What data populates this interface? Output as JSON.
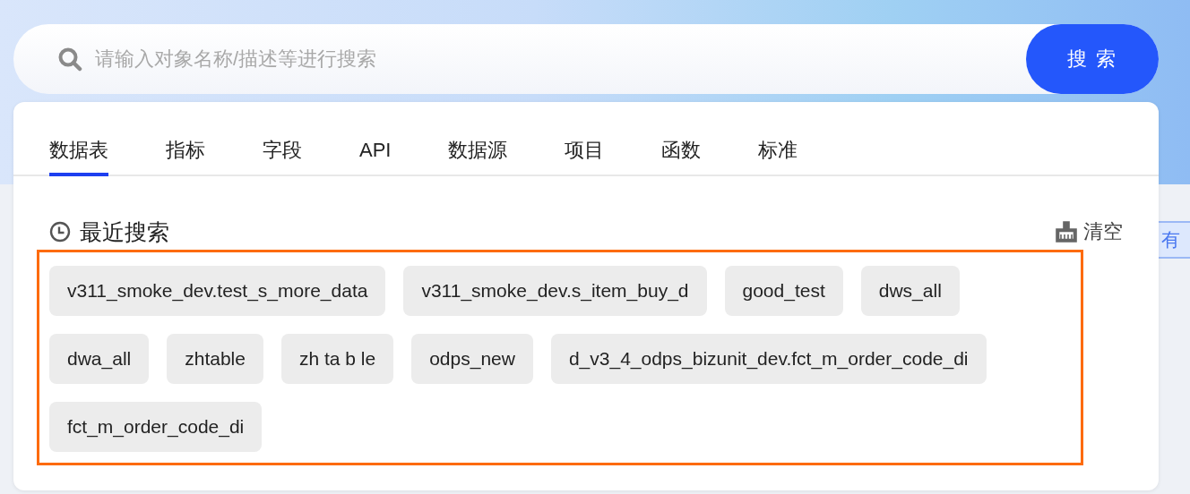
{
  "search": {
    "placeholder": "请输入对象名称/描述等进行搜索",
    "button": "搜 索"
  },
  "background": {
    "link_fragment": "有"
  },
  "tabs": [
    {
      "label": "数据表",
      "selected": true
    },
    {
      "label": "指标",
      "selected": false
    },
    {
      "label": "字段",
      "selected": false
    },
    {
      "label": "API",
      "selected": false
    },
    {
      "label": "数据源",
      "selected": false
    },
    {
      "label": "项目",
      "selected": false
    },
    {
      "label": "函数",
      "selected": false
    },
    {
      "label": "标准",
      "selected": false
    }
  ],
  "recent": {
    "title": "最近搜索",
    "clear": "清空",
    "items": [
      "v311_smoke_dev.test_s_more_data",
      "v311_smoke_dev.s_item_buy_d",
      "good_test",
      "dws_all",
      "dwa_all",
      "zhtable",
      "zh ta b le",
      "odps_new",
      "d_v3_4_odps_bizunit_dev.fct_m_order_code_di",
      "fct_m_order_code_di"
    ]
  }
}
